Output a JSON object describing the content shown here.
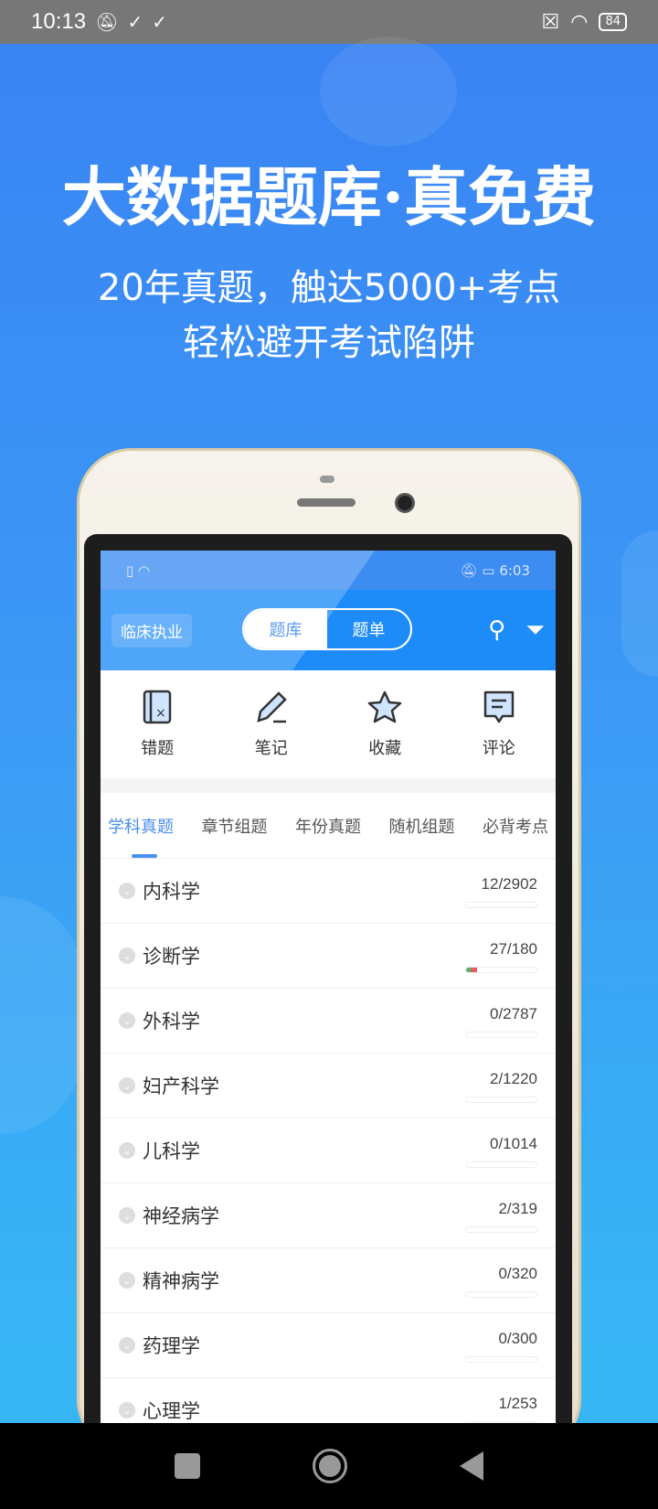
{
  "status_bar": {
    "time": "10:13",
    "battery": "84"
  },
  "hero": {
    "title": "大数据题库·真免费",
    "subtitle_line1": "20年真题，触达5000+考点",
    "subtitle_line2": "轻松避开考试陷阱"
  },
  "phone_status": {
    "time": "6:03"
  },
  "app_header": {
    "category": "临床执业",
    "seg_left": "题库",
    "seg_right": "题单",
    "active_segment": "题库"
  },
  "quick_actions": [
    {
      "label": "错题",
      "icon": "wrong-book-icon"
    },
    {
      "label": "笔记",
      "icon": "pencil-icon"
    },
    {
      "label": "收藏",
      "icon": "star-icon"
    },
    {
      "label": "评论",
      "icon": "comment-icon"
    }
  ],
  "tabs": [
    {
      "label": "学科真题",
      "active": true
    },
    {
      "label": "章节组题"
    },
    {
      "label": "年份真题"
    },
    {
      "label": "随机组题"
    },
    {
      "label": "必背考点"
    }
  ],
  "subjects": [
    {
      "name": "内科学",
      "count": "12/2902",
      "progress": 0.004
    },
    {
      "name": "诊断学",
      "count": "27/180",
      "progress": 0.15
    },
    {
      "name": "外科学",
      "count": "0/2787",
      "progress": 0
    },
    {
      "name": "妇产科学",
      "count": "2/1220",
      "progress": 0.002
    },
    {
      "name": "儿科学",
      "count": "0/1014",
      "progress": 0
    },
    {
      "name": "神经病学",
      "count": "2/319",
      "progress": 0.006
    },
    {
      "name": "精神病学",
      "count": "0/320",
      "progress": 0
    },
    {
      "name": "药理学",
      "count": "0/300",
      "progress": 0
    },
    {
      "name": "心理学",
      "count": "1/253",
      "progress": 0.004
    }
  ],
  "colors": {
    "accent": "#4a8ef0",
    "header": "#1e8cf8",
    "correct": "#4cb56f",
    "wrong": "#e85c5c"
  }
}
